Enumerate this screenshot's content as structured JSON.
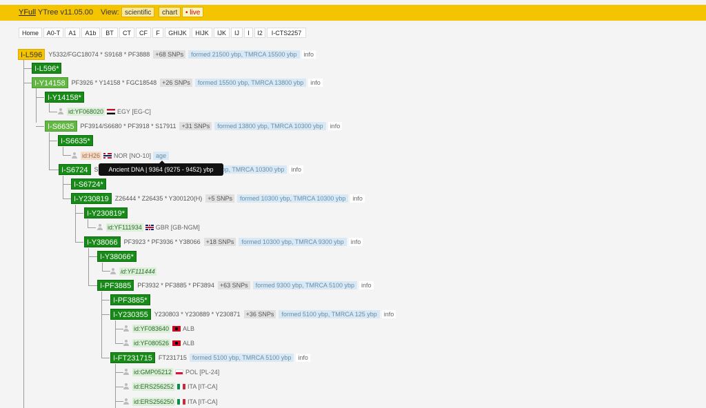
{
  "header": {
    "brand": "YFull",
    "version": "YTree v11.05.00",
    "view_label": "View:",
    "views": [
      "scientific",
      "chart",
      "• live"
    ]
  },
  "tabs": [
    "Home",
    "A0-T",
    "A1",
    "A1b",
    "BT",
    "CT",
    "CF",
    "F",
    "GHIJK",
    "HIJK",
    "IJK",
    "IJ",
    "I",
    "I2",
    "I-CTS2257"
  ],
  "tree": {
    "r0": {
      "name": "I-L596",
      "snps": "Y5332/FGC18074 * S9168 * PF3888",
      "count": "+68 SNPs",
      "formed": "formed 21500 ybp, TMRCA 15500 ybp",
      "info": "info"
    },
    "r1": {
      "name": "I-L596*"
    },
    "r2": {
      "name": "I-Y14158",
      "snps": "PF3926 * Y14158 * FGC18548",
      "count": "+26 SNPs",
      "formed": "formed 15500 ybp, TMRCA 13800 ybp",
      "info": "info"
    },
    "r3": {
      "name": "I-Y14158*"
    },
    "r4": {
      "id": "id:YF068020",
      "country": "EGY [EG-C]"
    },
    "r5": {
      "name": "I-S6635",
      "snps": "PF3914/S6680 * PF3918 * S17911",
      "count": "+31 SNPs",
      "formed": "formed 13800 ybp, TMRCA 10300 ybp",
      "info": "info"
    },
    "r6": {
      "name": "I-S6635*"
    },
    "r7": {
      "id": "id:H26",
      "country": "NOR [NO-10]",
      "age": "age"
    },
    "r8": {
      "name": "I-S6724",
      "snps": "S",
      "formed": "0 ybp, TMRCA 10300 ybp",
      "info": "info"
    },
    "r9": {
      "name": "I-S6724*"
    },
    "r10": {
      "name": "I-Y230819",
      "snps": "Z26444 * Z26435 * Y300120(H)",
      "count": "+5 SNPs",
      "formed": "formed 10300 ybp, TMRCA 10300 ybp",
      "info": "info"
    },
    "r11": {
      "name": "I-Y230819*"
    },
    "r12": {
      "id": "id:YF111934",
      "country": "GBR [GB-NGM]"
    },
    "r13": {
      "name": "I-Y38066",
      "snps": "PF3923 * PF3936 * Y38066",
      "count": "+18 SNPs",
      "formed": "formed 10300 ybp, TMRCA 9300 ybp",
      "info": "info"
    },
    "r14": {
      "name": "I-Y38066*"
    },
    "r15": {
      "id": "id:YF111444"
    },
    "r16": {
      "name": "I-PF3885",
      "snps": "PF3932 * PF3885 * PF3894",
      "count": "+63 SNPs",
      "formed": "formed 9300 ybp, TMRCA 5100 ybp",
      "info": "info"
    },
    "r17": {
      "name": "I-PF3885*"
    },
    "r18": {
      "name": "I-Y230355",
      "snps": "Y230803 * Y230889 * Y230871",
      "count": "+36 SNPs",
      "formed": "formed 5100 ybp, TMRCA 125 ybp",
      "info": "info"
    },
    "r19": {
      "id": "id:YF083640",
      "country": "ALB"
    },
    "r20": {
      "id": "id:YF080526",
      "country": "ALB"
    },
    "r21": {
      "name": "I-FT231715",
      "snps": "FT231715",
      "formed": "formed 5100 ybp, TMRCA 5100 ybp",
      "info": "info"
    },
    "r22": {
      "id": "id:GMP05212",
      "country": "POL [PL-24]"
    },
    "r23": {
      "id": "id:ERS256252",
      "country": "ITA [IT-CA]"
    },
    "r24": {
      "id": "id:ERS256250",
      "country": "ITA [IT-CA]"
    }
  },
  "tooltip": "Ancient DNA | 9364 (9275 - 9452) ybp"
}
